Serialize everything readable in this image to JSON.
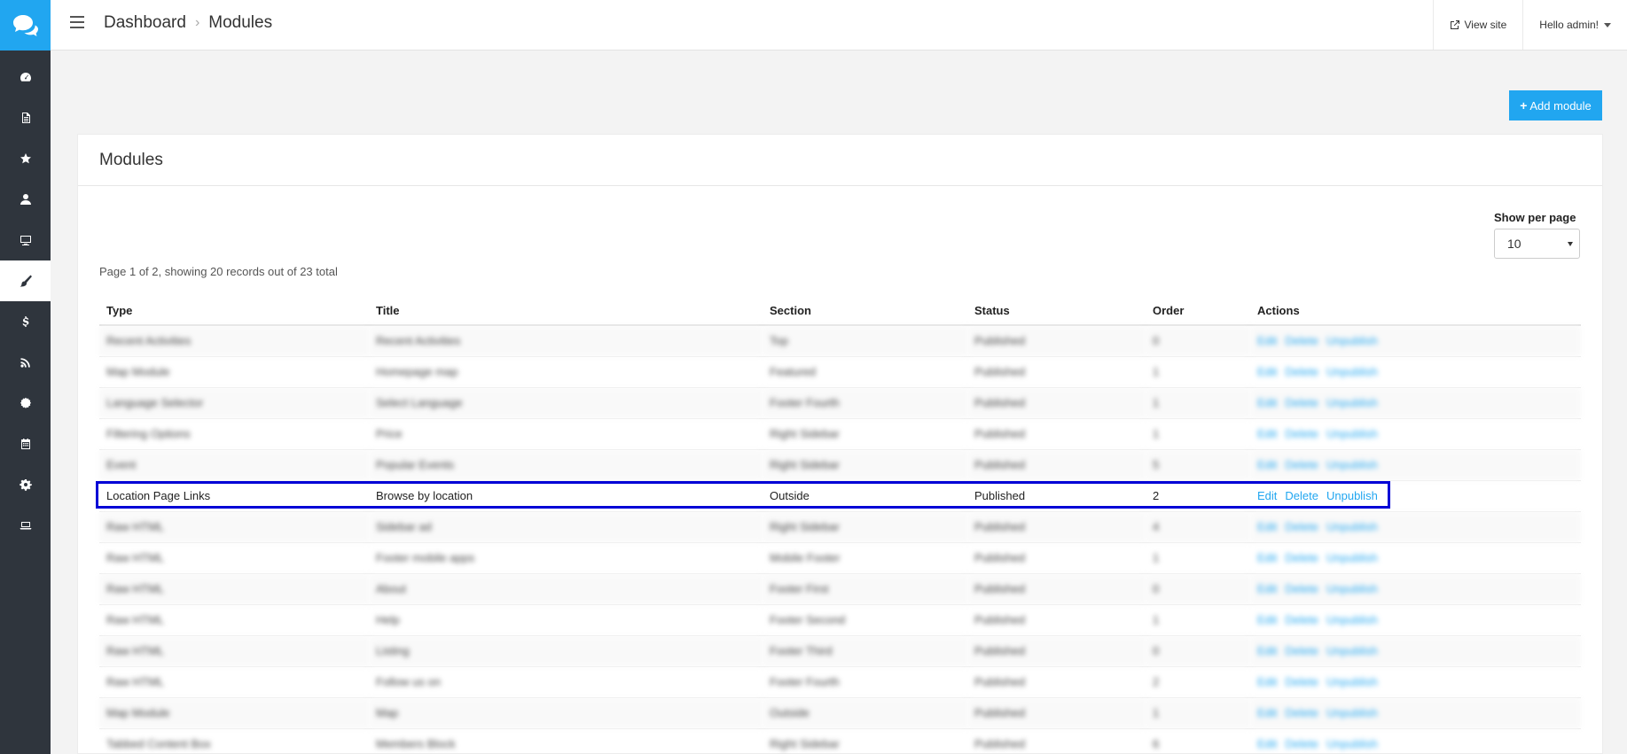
{
  "sidebar": {
    "logo_icon": "chat-bubbles-icon",
    "items": [
      {
        "name": "dashboard",
        "icon": "gauge-icon"
      },
      {
        "name": "pages",
        "icon": "document-icon"
      },
      {
        "name": "favorites",
        "icon": "star-icon"
      },
      {
        "name": "users",
        "icon": "user-icon"
      },
      {
        "name": "display",
        "icon": "monitor-icon"
      },
      {
        "name": "appearance",
        "icon": "brush-icon",
        "active": true
      },
      {
        "name": "payments",
        "icon": "dollar-icon"
      },
      {
        "name": "feeds",
        "icon": "rss-icon"
      },
      {
        "name": "badges",
        "icon": "certificate-icon"
      },
      {
        "name": "calendar",
        "icon": "calendar-icon"
      },
      {
        "name": "settings",
        "icon": "gear-icon"
      },
      {
        "name": "devices",
        "icon": "laptop-icon"
      }
    ]
  },
  "header": {
    "breadcrumb": [
      "Dashboard",
      "Modules"
    ],
    "view_site": "View site",
    "user_menu": "Hello admin!"
  },
  "actions": {
    "add_module": "Add module"
  },
  "card": {
    "title": "Modules",
    "per_page_label": "Show per page",
    "per_page_value": "10",
    "pager_info": "Page 1 of 2, showing 20 records out of 23 total"
  },
  "table": {
    "columns": [
      "Type",
      "Title",
      "Section",
      "Status",
      "Order",
      "Actions"
    ],
    "action_labels": [
      "Edit",
      "Delete",
      "Unpublish"
    ],
    "rows": [
      {
        "type": "Recent Activities",
        "title": "Recent Activities",
        "section": "Top",
        "status": "Published",
        "order": "0",
        "blurred": true
      },
      {
        "type": "Map Module",
        "title": "Homepage map",
        "section": "Featured",
        "status": "Published",
        "order": "1",
        "blurred": true
      },
      {
        "type": "Language Selector",
        "title": "Select Language",
        "section": "Footer Fourth",
        "status": "Published",
        "order": "1",
        "blurred": true
      },
      {
        "type": "Filtering Options",
        "title": "Price",
        "section": "Right Sidebar",
        "status": "Published",
        "order": "1",
        "blurred": true
      },
      {
        "type": "Event",
        "title": "Popular Events",
        "section": "Right Sidebar",
        "status": "Published",
        "order": "5",
        "blurred": true
      },
      {
        "type": "Location Page Links",
        "title": "Browse by location",
        "section": "Outside",
        "status": "Published",
        "order": "2",
        "blurred": false
      },
      {
        "type": "Raw HTML",
        "title": "Sidebar ad",
        "section": "Right Sidebar",
        "status": "Published",
        "order": "4",
        "blurred": true
      },
      {
        "type": "Raw HTML",
        "title": "Footer mobile apps",
        "section": "Mobile Footer",
        "status": "Published",
        "order": "1",
        "blurred": true
      },
      {
        "type": "Raw HTML",
        "title": "About",
        "section": "Footer First",
        "status": "Published",
        "order": "0",
        "blurred": true
      },
      {
        "type": "Raw HTML",
        "title": "Help",
        "section": "Footer Second",
        "status": "Published",
        "order": "1",
        "blurred": true
      },
      {
        "type": "Raw HTML",
        "title": "Listing",
        "section": "Footer Third",
        "status": "Published",
        "order": "0",
        "blurred": true
      },
      {
        "type": "Raw HTML",
        "title": "Follow us on",
        "section": "Footer Fourth",
        "status": "Published",
        "order": "2",
        "blurred": true
      },
      {
        "type": "Map Module",
        "title": "Map",
        "section": "Outside",
        "status": "Published",
        "order": "1",
        "blurred": true
      },
      {
        "type": "Tabbed Content Box",
        "title": "Members Block",
        "section": "Right Sidebar",
        "status": "Published",
        "order": "6",
        "blurred": true
      }
    ]
  },
  "colors": {
    "sidebar_bg": "#2f353d",
    "accent": "#21a6f0",
    "highlight_border": "#0000d6"
  }
}
